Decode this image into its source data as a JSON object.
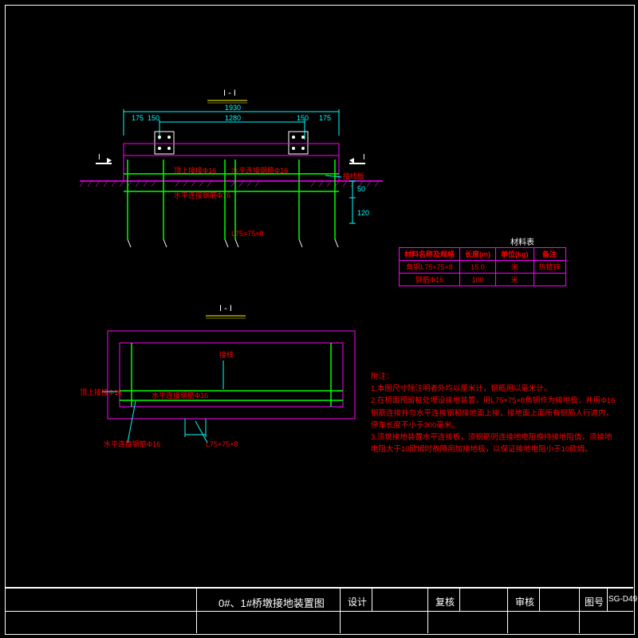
{
  "titleblock": {
    "title": "0#、1#桥墩接地装置图",
    "design": "设计",
    "review": "复核",
    "check": "审核",
    "sheet_label": "图号",
    "sheet_no": "SG-D49"
  },
  "sections": {
    "header_top": "I - I",
    "header_sec": "I - I",
    "marker_left": "I",
    "marker_right": "I"
  },
  "dims": {
    "d1930": "1930",
    "d1280": "1280",
    "d175a": "175",
    "d150a": "150",
    "d150b": "150",
    "d175b": "175",
    "d50": "50",
    "d120": "120"
  },
  "labels": {
    "top_conn": "顶上接接Φ16",
    "horiz_conn": "水平连接钢筋Φ16",
    "horiz_conn2": "水平连接钢筋Φ16",
    "angle": "L75×75×8",
    "jiexian": "接线",
    "horiz_conn3": "水平连接钢筋Φ16",
    "horiz_conn4": "水平连接钢筋Φ16",
    "angle2": "L75×75×8",
    "top_conn2": "顶上接接Φ16",
    "jiexian_lbl": "接线板"
  },
  "table": {
    "title": "材料表",
    "h1": "材料名称及规格",
    "h2": "长度(m)",
    "h3": "单位(kg)",
    "h4": "备注",
    "r1c1": "角钢L75×75×8",
    "r1c2": "15.0",
    "r1c3": "米",
    "r1c4": "热镀锌",
    "r2c1": "钢筋Φ16",
    "r2c2": "100",
    "r2c3": "米",
    "r2c4": ""
  },
  "notes": {
    "hdr": "附注：",
    "n1": "1.本图尺寸除注明者外均以厘米计，钢筋用以毫米计。",
    "n2": "2.在桥面预留桩处埋设接地装置，用L75×75×8角钢作为接地极，并用Φ16钢筋连接并与水平连接钢和接地面上接，接地面上面所有钢筋人行道内，停车长度不小于300毫米。",
    "n3": "3.须筑接地装置水平连接板，须钢筋则连接地电阻换持接地阻值，须接地电阻大于10欧姆时故障用加接地极，以保证接地电阻小于10欧姆。"
  },
  "chart_data": {
    "type": "table",
    "title": "材料表",
    "columns": [
      "材料名称及规格",
      "长度(m)",
      "单位(kg)",
      "备注"
    ],
    "rows": [
      [
        "角钢L75×75×8",
        15.0,
        "米",
        "热镀锌"
      ],
      [
        "钢筋Φ16",
        100,
        "米",
        ""
      ]
    ]
  }
}
